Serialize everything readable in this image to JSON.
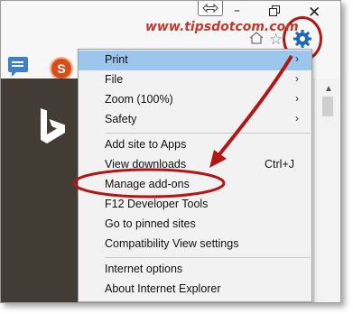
{
  "watermark": "www.tipsdotcom.com",
  "window": {
    "min_glyph": "–",
    "close_glyph": "✕"
  },
  "toolbar": {
    "star_glyph": "☆",
    "s_logo": "S"
  },
  "menu": {
    "items": [
      {
        "label": "Print",
        "arrow": "›",
        "shortcut": ""
      },
      {
        "label": "File",
        "arrow": "›",
        "shortcut": ""
      },
      {
        "label": "Zoom (100%)",
        "arrow": "›",
        "shortcut": ""
      },
      {
        "label": "Safety",
        "arrow": "›",
        "shortcut": ""
      },
      {
        "label": "Add site to Apps",
        "arrow": "",
        "shortcut": ""
      },
      {
        "label": "View downloads",
        "arrow": "",
        "shortcut": "Ctrl+J"
      },
      {
        "label": "Manage add-ons",
        "arrow": "",
        "shortcut": ""
      },
      {
        "label": "F12 Developer Tools",
        "arrow": "",
        "shortcut": ""
      },
      {
        "label": "Go to pinned sites",
        "arrow": "",
        "shortcut": ""
      },
      {
        "label": "Compatibility View settings",
        "arrow": "",
        "shortcut": ""
      },
      {
        "label": "Internet options",
        "arrow": "",
        "shortcut": ""
      },
      {
        "label": "About Internet Explorer",
        "arrow": "",
        "shortcut": ""
      }
    ]
  },
  "colors": {
    "annotation_red": "#b01818",
    "highlight": "#9cc6ee",
    "bing_bg": "#433c35",
    "watermark": "#c0392b"
  }
}
